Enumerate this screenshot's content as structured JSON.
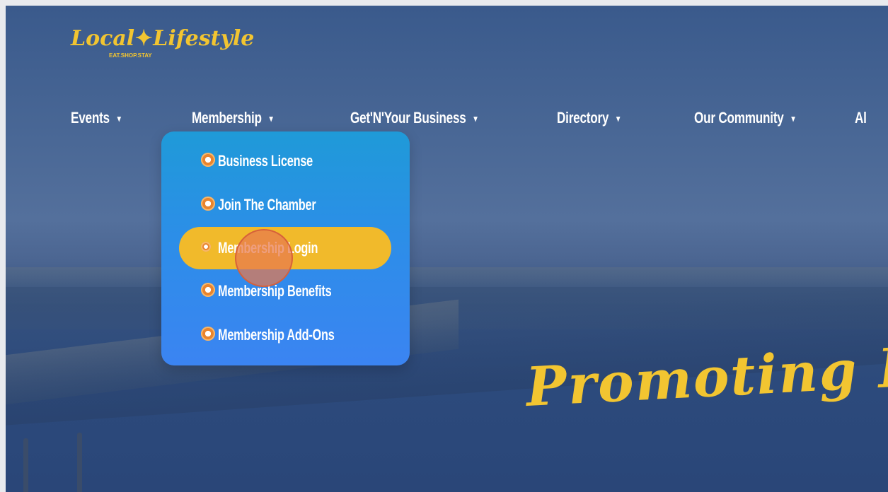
{
  "logo": {
    "main_left": "Local",
    "main_right": "Lifestyle",
    "tagline": "EAT.SHOP.STAY",
    "star_icon": "compass-star-icon"
  },
  "nav": {
    "items": [
      {
        "label": "Events",
        "caret": "▾"
      },
      {
        "label": "Membership",
        "caret": "▾"
      },
      {
        "label": "Get'N'Your Business",
        "caret": "▾"
      },
      {
        "label": "Directory",
        "caret": "▾"
      },
      {
        "label": "Our Community",
        "caret": "▾"
      },
      {
        "label": "Al"
      }
    ]
  },
  "membership_menu": {
    "items": [
      {
        "label": "Business License",
        "icon": "compass-icon"
      },
      {
        "label": "Join The Chamber",
        "icon": "compass-icon"
      },
      {
        "label": "Membership Login",
        "icon": "compass-icon",
        "highlighted": true
      },
      {
        "label": "Membership Benefits",
        "icon": "compass-icon"
      },
      {
        "label": "Membership Add-Ons",
        "icon": "compass-icon"
      }
    ]
  },
  "hero": {
    "headline": "Promoting Busi"
  },
  "colors": {
    "accent_yellow": "#f2c531",
    "dropdown_top": "#1f9ad8",
    "dropdown_bottom": "#3b84f2",
    "active_pill": "#f1ba2b",
    "click_marker": "#e8784e"
  }
}
